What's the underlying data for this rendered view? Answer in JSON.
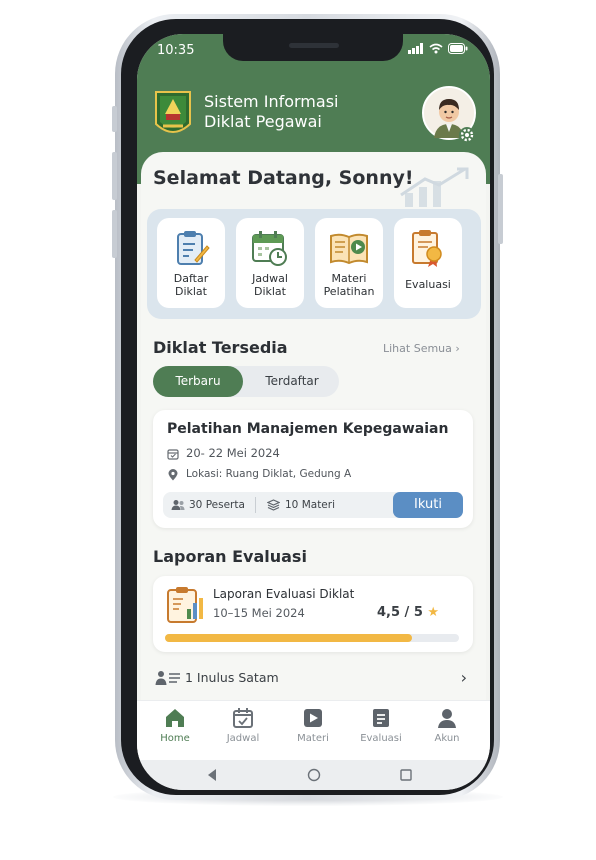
{
  "status_bar": {
    "time": "10:35"
  },
  "header": {
    "title_line1": "Sistem Informasi",
    "title_line2": "Diklat Pegawai"
  },
  "greeting": "Selamat Datang, Sonny!",
  "quick_actions": [
    {
      "line1": "Daftar",
      "line2": "Diklat",
      "icon": "clipboard-icon"
    },
    {
      "line1": "Jadwal",
      "line2": "Diklat",
      "icon": "calendar-clock-icon"
    },
    {
      "line1": "Materi",
      "line2": "Pelatihan",
      "icon": "book-video-icon"
    },
    {
      "line1": "Evaluasi",
      "line2": "",
      "icon": "certificate-icon"
    }
  ],
  "courses_section": {
    "title": "Diklat Tersedia",
    "see_all": "Lihat Semua",
    "tabs": [
      {
        "label": "Terbaru",
        "active": true
      },
      {
        "label": "Terdaftar",
        "active": false
      }
    ]
  },
  "course": {
    "title": "Pelatihan Manajemen Kepegawaian",
    "date": "20- 22 Mei 2024",
    "location": "Lokasi: Ruang Diklat, Gedung A",
    "participants": "30 Peserta",
    "materials": "10 Materi",
    "join_label": "Ikuti"
  },
  "report_section": {
    "title": "Laporan Evaluasi",
    "report_title": "Laporan Evaluasi Diklat",
    "report_date": "10–15 Mei 2024",
    "score": "4,5 / 5",
    "progress": 0.84
  },
  "graduates_row": {
    "label": "1 Inulus Satam"
  },
  "bottom_nav": [
    {
      "label": "Home",
      "active": true
    },
    {
      "label": "Jadwal",
      "active": false
    },
    {
      "label": "Materi",
      "active": false
    },
    {
      "label": "Evaluasi",
      "active": false
    },
    {
      "label": "Akun",
      "active": false
    }
  ],
  "colors": {
    "primary": "#4f7d54",
    "accent_blue": "#5b8ec4",
    "progress": "#f2b844",
    "panel": "#dbe5ed"
  }
}
